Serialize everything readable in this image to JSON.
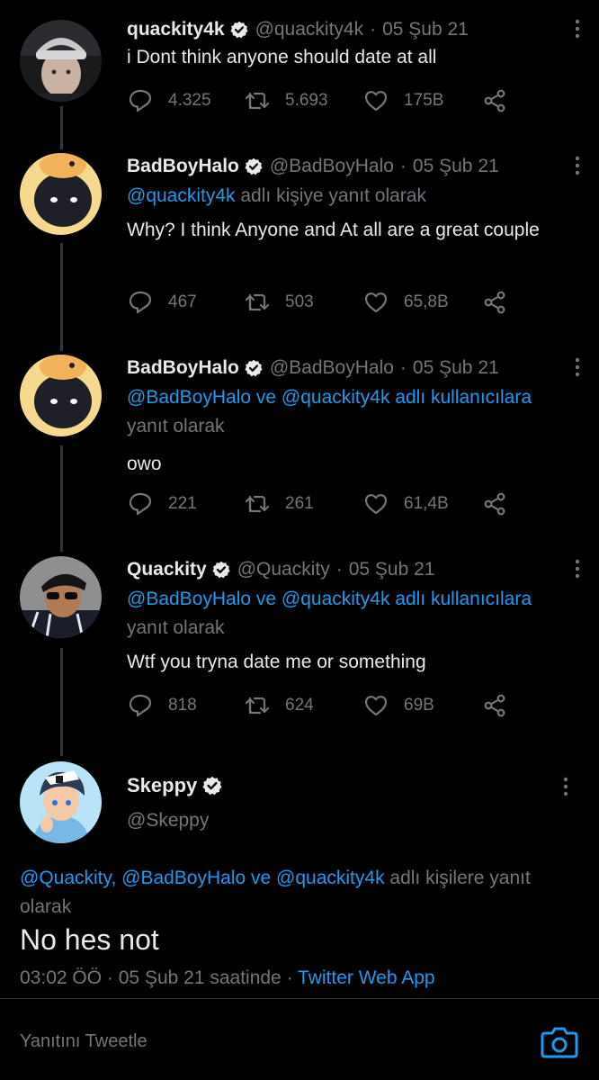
{
  "tweets": [
    {
      "name": "quackity4k",
      "handle": "@quackity4k",
      "sep": "·",
      "date": "05 Şub 21",
      "reply_prefix": "",
      "reply_mentions": "",
      "reply_suffix": "",
      "text": "i Dont think anyone should date at all",
      "replies": "4.325",
      "retweets": "5.693",
      "likes": "175B"
    },
    {
      "name": "BadBoyHalo",
      "handle": "@BadBoyHalo",
      "sep": "·",
      "date": "05 Şub 21",
      "reply_mentions": "@quackity4k",
      "reply_suffix": " adlı kişiye yanıt olarak",
      "text": "Why? I think Anyone and At all are a great couple",
      "replies": "467",
      "retweets": "503",
      "likes": "65,8B"
    },
    {
      "name": "BadBoyHalo",
      "handle": "@BadBoyHalo",
      "sep": "·",
      "date": "05 Şub 21",
      "reply_mentions": "@BadBoyHalo ve @quackity4k adlı kullanıcılara",
      "reply_suffix": "yanıt olarak",
      "text": "owo",
      "replies": "221",
      "retweets": "261",
      "likes": "61,4B"
    },
    {
      "name": "Quackity",
      "handle": "@Quackity",
      "sep": "·",
      "date": "05 Şub 21",
      "reply_mentions": "@BadBoyHalo ve @quackity4k adlı kullanıcılara",
      "reply_suffix": "yanıt olarak",
      "text": "Wtf you tryna date me or something",
      "replies": "818",
      "retweets": "624",
      "likes": "69B"
    }
  ],
  "focused": {
    "name": "Skeppy",
    "handle": "@Skeppy",
    "reply_mentions": "@Quackity, @BadBoyHalo ve @quackity4k",
    "reply_suffix": " adlı kişilere yanıt olarak",
    "text": "No hes not",
    "time": "03:02 ÖÖ",
    "sep": "·",
    "date": "05 Şub 21 saatinde",
    "sep2": "·",
    "source": "Twitter Web App"
  },
  "reply_bar": {
    "placeholder": "Yanıtını Tweetle"
  },
  "colors": {
    "background": "#000000",
    "accent": "#1d9bf0",
    "muted": "#71767b",
    "text": "#e7e9ea"
  },
  "icons": [
    "verified-icon",
    "more-icon",
    "reply-icon",
    "retweet-icon",
    "like-icon",
    "share-icon",
    "camera-icon"
  ]
}
